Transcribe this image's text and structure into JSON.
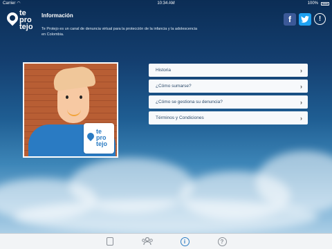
{
  "status_bar": {
    "carrier": "Carrier",
    "time": "10:34 AM",
    "battery": "100%"
  },
  "logo": {
    "lines": [
      "te",
      "pro",
      "tejo"
    ]
  },
  "header": {
    "title": "Información",
    "description": "Te Protejo es un canal de denuncia virtual para la protección de la infancia y la adolescencia en Colombia."
  },
  "social": {
    "facebook_glyph": "f",
    "twitter_glyph": "t",
    "info_glyph": "!"
  },
  "badge": {
    "lines": [
      "te",
      "pro",
      "tejo"
    ]
  },
  "menu": {
    "items": [
      {
        "label": "Historia"
      },
      {
        "label": "¿Cómo sumarse?"
      },
      {
        "label": "¿Cómo se gestiona su denuncia?"
      },
      {
        "label": "Términos y Condiciones"
      }
    ]
  },
  "tabs": [
    {
      "name": "report",
      "active": false
    },
    {
      "name": "people",
      "active": false
    },
    {
      "name": "info",
      "glyph": "i",
      "active": true
    },
    {
      "name": "help",
      "glyph": "?",
      "active": false
    }
  ],
  "colors": {
    "accent": "#2a7bc3",
    "facebook": "#3b5998",
    "twitter": "#1da1f2"
  }
}
